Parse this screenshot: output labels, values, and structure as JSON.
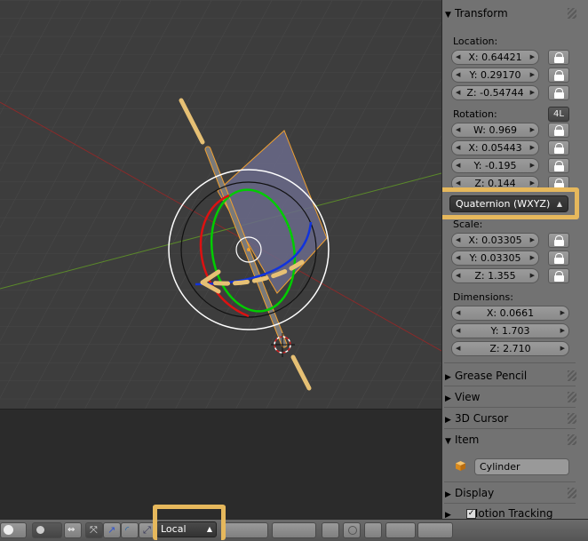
{
  "panel": {
    "transform_title": "Transform",
    "location_label": "Location:",
    "location": [
      "X: 0.64421",
      "Y: 0.29170",
      "Z: -0.54744"
    ],
    "rotation_label": "Rotation:",
    "rotation_badge": "4L",
    "rotation": [
      "W: 0.969",
      "X: 0.05443",
      "Y: -0.195",
      "Z: 0.144"
    ],
    "rotation_mode": "Quaternion (WXYZ)",
    "scale_label": "Scale:",
    "scale": [
      "X: 0.03305",
      "Y: 0.03305",
      "Z: 1.355"
    ],
    "dimensions_label": "Dimensions:",
    "dimensions": [
      "X: 0.0661",
      "Y: 1.703",
      "Z: 2.710"
    ],
    "grease_pencil": "Grease Pencil",
    "view": "View",
    "cursor": "3D Cursor",
    "item": "Item",
    "item_name": "Cylinder",
    "display": "Display",
    "motion_tracking": "Motion Tracking"
  },
  "bottombar": {
    "orientation": "Local"
  },
  "colors": {
    "highlight": "#e6b85c",
    "x_axis": "#8a2a2a",
    "y_axis": "#5b8a2a",
    "selected": "#f0a030"
  }
}
